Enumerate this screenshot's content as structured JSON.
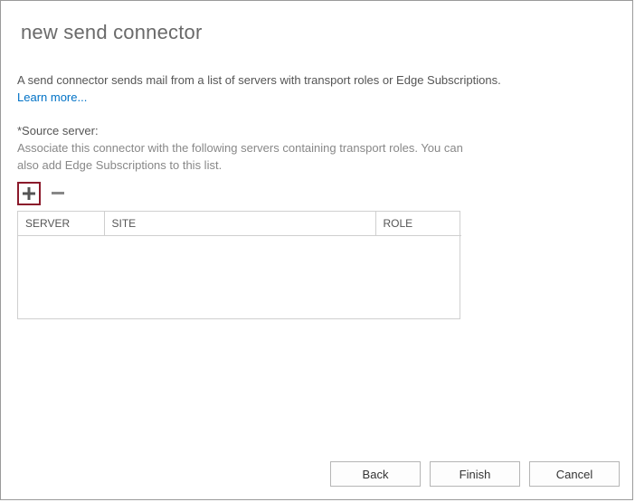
{
  "page": {
    "title": "new send connector",
    "intro": "A send connector sends mail from a list of servers with transport roles or Edge Subscriptions.",
    "learnMoreLabel": "Learn more...",
    "sourceServer": {
      "label": "*Source server:",
      "help": "Associate this connector with the following servers containing transport roles. You can also add Edge Subscriptions to this list."
    },
    "table": {
      "headers": {
        "server": "SERVER",
        "site": "SITE",
        "role": "ROLE"
      },
      "rows": []
    },
    "icons": {
      "add": "plus-icon",
      "remove": "minus-icon"
    }
  },
  "buttons": {
    "back": "Back",
    "finish": "Finish",
    "cancel": "Cancel"
  }
}
